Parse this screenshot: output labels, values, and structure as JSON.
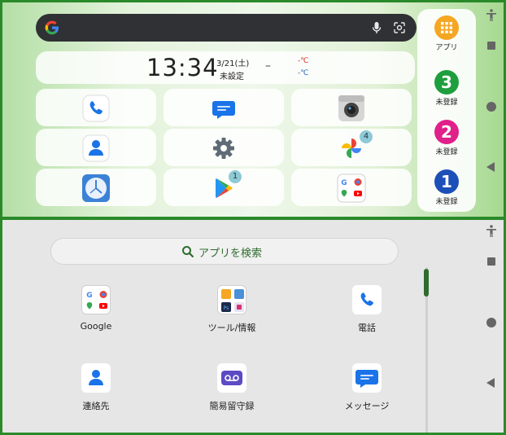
{
  "home": {
    "clock": {
      "time": "13:34",
      "date": "3/21(土)",
      "status": "未設定",
      "dash": "–",
      "temp_high": "-℃",
      "temp_low": "-℃"
    },
    "dock_tiles": [
      {
        "icon": "phone-icon"
      },
      {
        "icon": "messages-icon"
      },
      {
        "icon": "camera-icon"
      },
      {
        "icon": "contacts-icon"
      },
      {
        "icon": "settings-gear-icon"
      },
      {
        "icon": "photos-icon",
        "badge": "4"
      },
      {
        "icon": "clock-app-icon"
      },
      {
        "icon": "play-store-icon",
        "badge": "1"
      },
      {
        "icon": "google-folder-icon"
      }
    ],
    "side_panel": {
      "apps_label": "アプリ",
      "shortcuts": [
        {
          "number": "3",
          "label": "未登録",
          "color": "#1e9e3e"
        },
        {
          "number": "2",
          "label": "未登録",
          "color": "#e0218a"
        },
        {
          "number": "1",
          "label": "未登録",
          "color": "#1d4fb8"
        }
      ]
    }
  },
  "drawer": {
    "search_placeholder": "アプリを検索",
    "apps": [
      {
        "name": "Google",
        "icon": "google-folder-icon"
      },
      {
        "name": "ツール/情報",
        "icon": "tools-folder-icon"
      },
      {
        "name": "電話",
        "icon": "phone-icon"
      },
      {
        "name": "連絡先",
        "icon": "contacts-icon"
      },
      {
        "name": "簡易留守録",
        "icon": "voicemail-icon"
      },
      {
        "name": "メッセージ",
        "icon": "messages-icon"
      }
    ]
  },
  "colors": {
    "frame": "#2a8a2a",
    "accent_green": "#2e6b2e",
    "search_dark": "#2f3134",
    "apps_orange": "#f5a623"
  }
}
